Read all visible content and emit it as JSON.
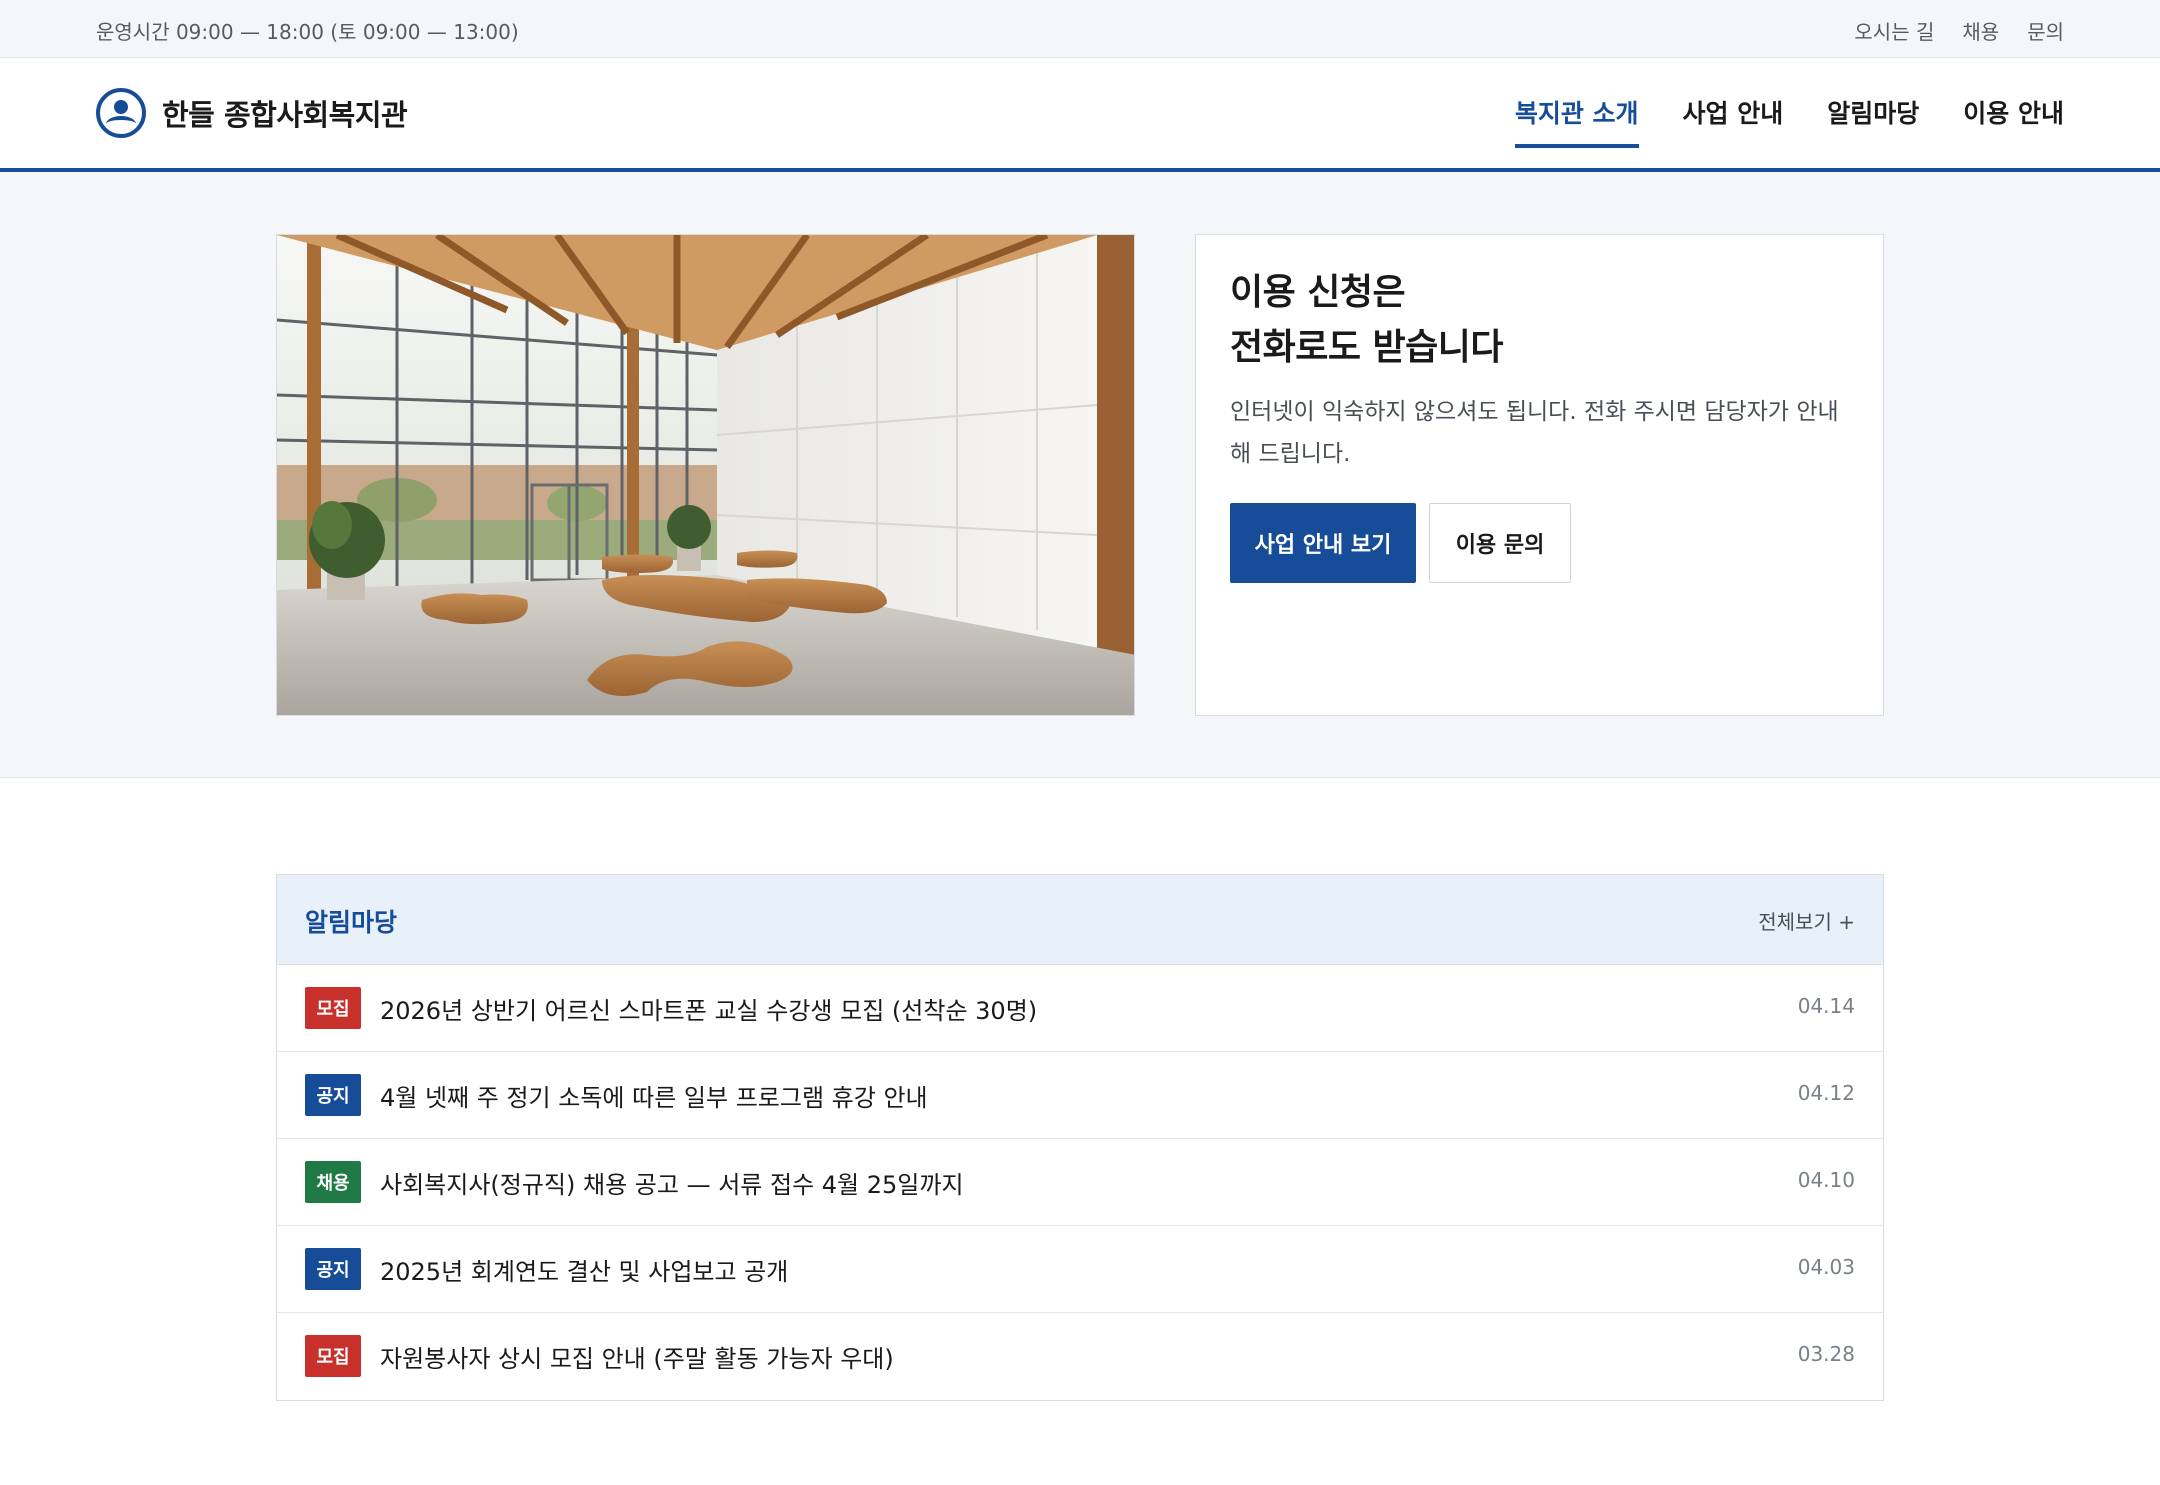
{
  "utility": {
    "hours": "운영시간 09:00 — 18:00 (토 09:00 — 13:00)",
    "links": [
      "오시는 길",
      "채용",
      "문의"
    ]
  },
  "header": {
    "brand_name": "한들 종합사회복지관",
    "logo_icon": "person-circle-icon",
    "nav": [
      "복지관 소개",
      "사업 안내",
      "알림마당",
      "이용 안내"
    ],
    "active_nav": "복지관 소개"
  },
  "hero": {
    "title_line1": "이용 신청은",
    "title_line2": "전화로도 받습니다",
    "description": "인터넷이 익숙하지 않으셔도 됩니다. 전화 주시면 담당자가 안내해 드립니다.",
    "primary_button": "사업 안내 보기",
    "secondary_button": "이용 문의"
  },
  "board": {
    "title": "알림마당",
    "more_link": "전체보기 +",
    "rows": [
      {
        "tag": "모집",
        "tag_color": "#c8302c",
        "title": "2026년 상반기 어르신 스마트폰 교실 수강생 모집 (선착순 30명)",
        "date": "04.14"
      },
      {
        "tag": "공지",
        "tag_color": "#174d98",
        "title": "4월 넷째 주 정기 소독에 따른 일부 프로그램 휴강 안내",
        "date": "04.12"
      },
      {
        "tag": "채용",
        "tag_color": "#1f7a45",
        "title": "사회복지사(정규직) 채용 공고 — 서류 접수 4월 25일까지",
        "date": "04.10"
      },
      {
        "tag": "공지",
        "tag_color": "#174d98",
        "title": "2025년 회계연도 결산 및 사업보고 공개",
        "date": "04.03"
      },
      {
        "tag": "모집",
        "tag_color": "#c8302c",
        "title": "자원봉사자 상시 모집 안내 (주말 활동 가능자 우대)",
        "date": "03.28"
      }
    ]
  },
  "colors": {
    "brand": "#174d98",
    "background": "#f4f6f9",
    "board_header": "#e8f0f9"
  }
}
